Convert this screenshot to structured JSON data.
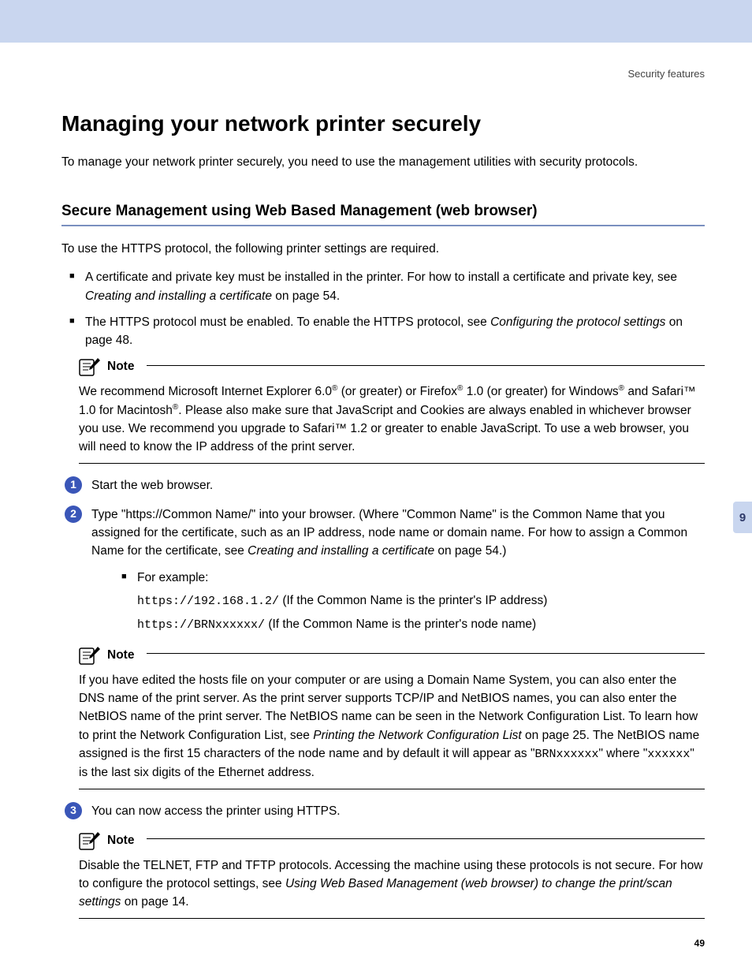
{
  "header_label": "Security features",
  "title": "Managing your network printer securely",
  "intro": "To manage your network printer securely, you need to use the management utilities with security protocols.",
  "section_heading": "Secure Management using Web Based Management (web browser)",
  "https_intro": "To use the HTTPS protocol, the following printer settings are required.",
  "bullets": {
    "b1_a": "A certificate and private key must be installed in the printer. For how to install a certificate and private key, see ",
    "b1_link": "Creating and installing a certificate",
    "b1_b": " on page 54.",
    "b2_a": "The HTTPS protocol must be enabled. To enable the HTTPS protocol, see ",
    "b2_link": "Configuring the protocol settings",
    "b2_b": " on page 48."
  },
  "note_label": "Note",
  "note1": {
    "t1": "We recommend Microsoft Internet Explorer 6.0",
    "t2": " (or greater) or Firefox",
    "t3": " 1.0 (or greater) for Windows",
    "t4": " and Safari™ 1.0 for Macintosh",
    "t5": ". Please also make sure that JavaScript and Cookies are always enabled in whichever browser you use. We recommend you upgrade to Safari™ 1.2 or greater to enable JavaScript. To use a web browser, you will need to know the IP address of the print server."
  },
  "steps": {
    "s1": "Start the web browser.",
    "s2_a": "Type \"https://Common Name/\" into your browser. (Where \"Common Name\" is the Common Name that you assigned for the certificate, such as an IP address, node name or domain name. For how to assign a Common Name for the certificate, see ",
    "s2_link": "Creating and installing a certificate",
    "s2_b": " on page 54.)",
    "s2_example_label": "For example:",
    "s2_ex1_code": "https://192.168.1.2/",
    "s2_ex1_rest": " (If the Common Name is the printer's IP address)",
    "s2_ex2_code": "https://BRNxxxxxx/",
    "s2_ex2_rest": " (If the Common Name is the printer's node name)",
    "s3": "You can now access the printer using HTTPS."
  },
  "note2": {
    "t1": "If you have edited the hosts file on your computer or are using a Domain Name System, you can also enter the DNS name of the print server. As the print server supports TCP/IP and NetBIOS names, you can also enter the NetBIOS name of the print server. The NetBIOS name can be seen in the Network Configuration List. To learn how to print the Network Configuration List, see ",
    "t1_link": "Printing the Network Configuration List",
    "t2": " on page 25. The NetBIOS name assigned is the first 15 characters of the node name and by default it will appear as \"",
    "t2_code1": "BRNxxxxxx",
    "t3": "\" where \"",
    "t2_code2": "xxxxxx",
    "t4": "\" is the last six digits of the Ethernet address."
  },
  "note3": {
    "t1": "Disable the TELNET, FTP and TFTP protocols. Accessing the machine using these protocols is not secure. For how to configure the protocol settings, see ",
    "t1_link": "Using Web Based Management (web browser) to change the print/scan settings",
    "t2": " on page 14."
  },
  "side_tab": "9",
  "page_num": "49",
  "reg": "®"
}
